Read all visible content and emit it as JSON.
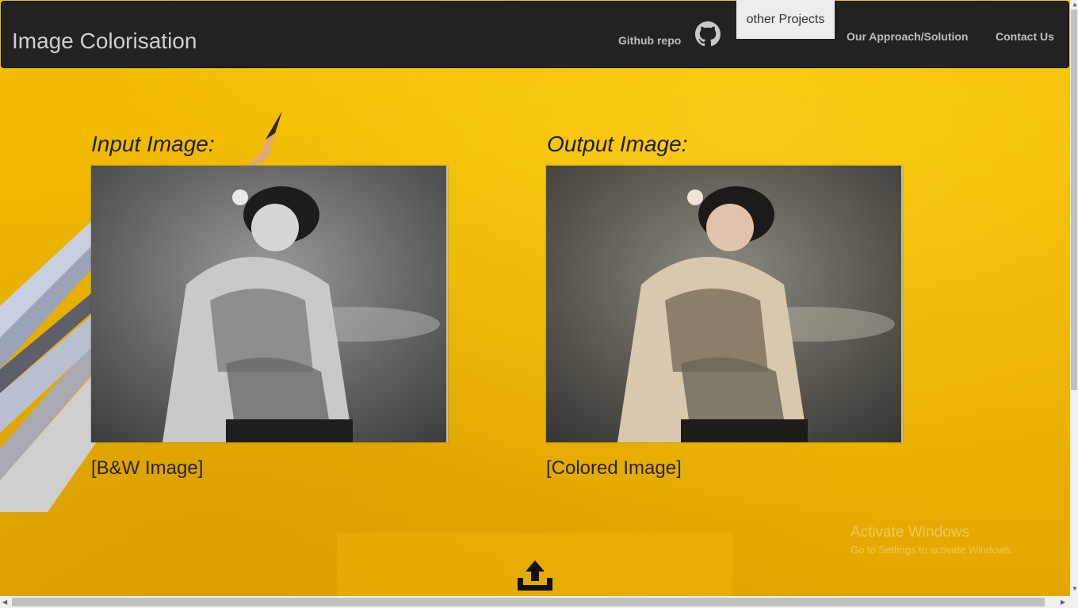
{
  "navbar": {
    "brand": "Image Colorisation",
    "github_label": "Github repo",
    "github_icon": "github-icon",
    "other_projects": "other Projects",
    "approach": "Our Approach/Solution",
    "contact": "Contact Us"
  },
  "main": {
    "input_heading": "Input Image:",
    "output_heading": "Output Image:",
    "input_caption": "[B&W Image]",
    "output_caption": "[Colored Image]",
    "upload_icon": "upload-icon"
  },
  "watermark": {
    "title": "Activate Windows",
    "subtitle": "Go to Settings to activate Windows."
  },
  "colors": {
    "background": "#eeb602",
    "navbar": "#222222",
    "nav_text": "#bdbdbd"
  }
}
